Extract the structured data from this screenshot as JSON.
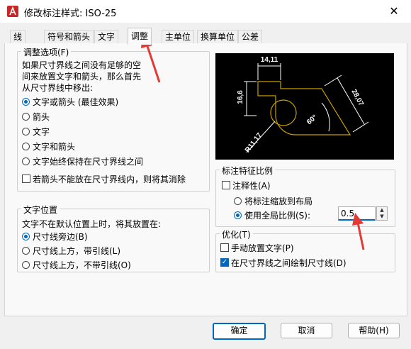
{
  "window": {
    "title": "修改标注样式: ISO-25",
    "close_glyph": "✕"
  },
  "tabs": [
    {
      "label": "线"
    },
    {
      "label": "符号和箭头"
    },
    {
      "label": "文字"
    },
    {
      "label": "调整"
    },
    {
      "label": "主单位"
    },
    {
      "label": "换算单位"
    },
    {
      "label": "公差"
    }
  ],
  "fit_options": {
    "legend": "调整选项(F)",
    "description": [
      "如果尺寸界线之间没有足够的空",
      "间来放置文字和箭头，那么首先",
      "从尺寸界线中移出:"
    ],
    "options": [
      {
        "label": "文字或箭头 (最佳效果)",
        "selected": true
      },
      {
        "label": "箭头",
        "selected": false
      },
      {
        "label": "文字",
        "selected": false
      },
      {
        "label": "文字和箭头",
        "selected": false
      },
      {
        "label": "文字始终保持在尺寸界线之间",
        "selected": false
      }
    ],
    "suppress_arrows": {
      "label": "若箭头不能放在尺寸界线内，则将其消除",
      "checked": false
    }
  },
  "text_placement": {
    "legend": "文字位置",
    "description": "文字不在默认位置上时，将其放置在:",
    "options": [
      {
        "label": "尺寸线旁边(B)",
        "selected": true
      },
      {
        "label": "尺寸线上方，带引线(L)",
        "selected": false
      },
      {
        "label": "尺寸线上方，不带引线(O)",
        "selected": false
      }
    ]
  },
  "preview": {
    "dim_top": "14,11",
    "dim_left": "16,6",
    "dim_right": "28,07",
    "dim_angle": "60°",
    "dim_radius": "R11,17"
  },
  "scale": {
    "legend": "标注特征比例",
    "annotative": {
      "label": "注释性(A)",
      "checked": false
    },
    "options": [
      {
        "label": "将标注缩放到布局",
        "selected": false
      },
      {
        "label": "使用全局比例(S):",
        "selected": true
      }
    ],
    "global_scale_value": "0.5",
    "spin_up": "▲",
    "spin_down": "▼"
  },
  "fine_tuning": {
    "legend": "优化(T)",
    "options": [
      {
        "label": "手动放置文字(P)",
        "checked": false
      },
      {
        "label": "在尺寸界线之间绘制尺寸线(D)",
        "checked": true
      }
    ]
  },
  "buttons": {
    "ok": "确定",
    "cancel": "取消",
    "help": "帮助(H)"
  },
  "colors": {
    "accent": "#0067c0",
    "preview_line": "#c8a000",
    "annotation_arrow": "#e53935"
  }
}
